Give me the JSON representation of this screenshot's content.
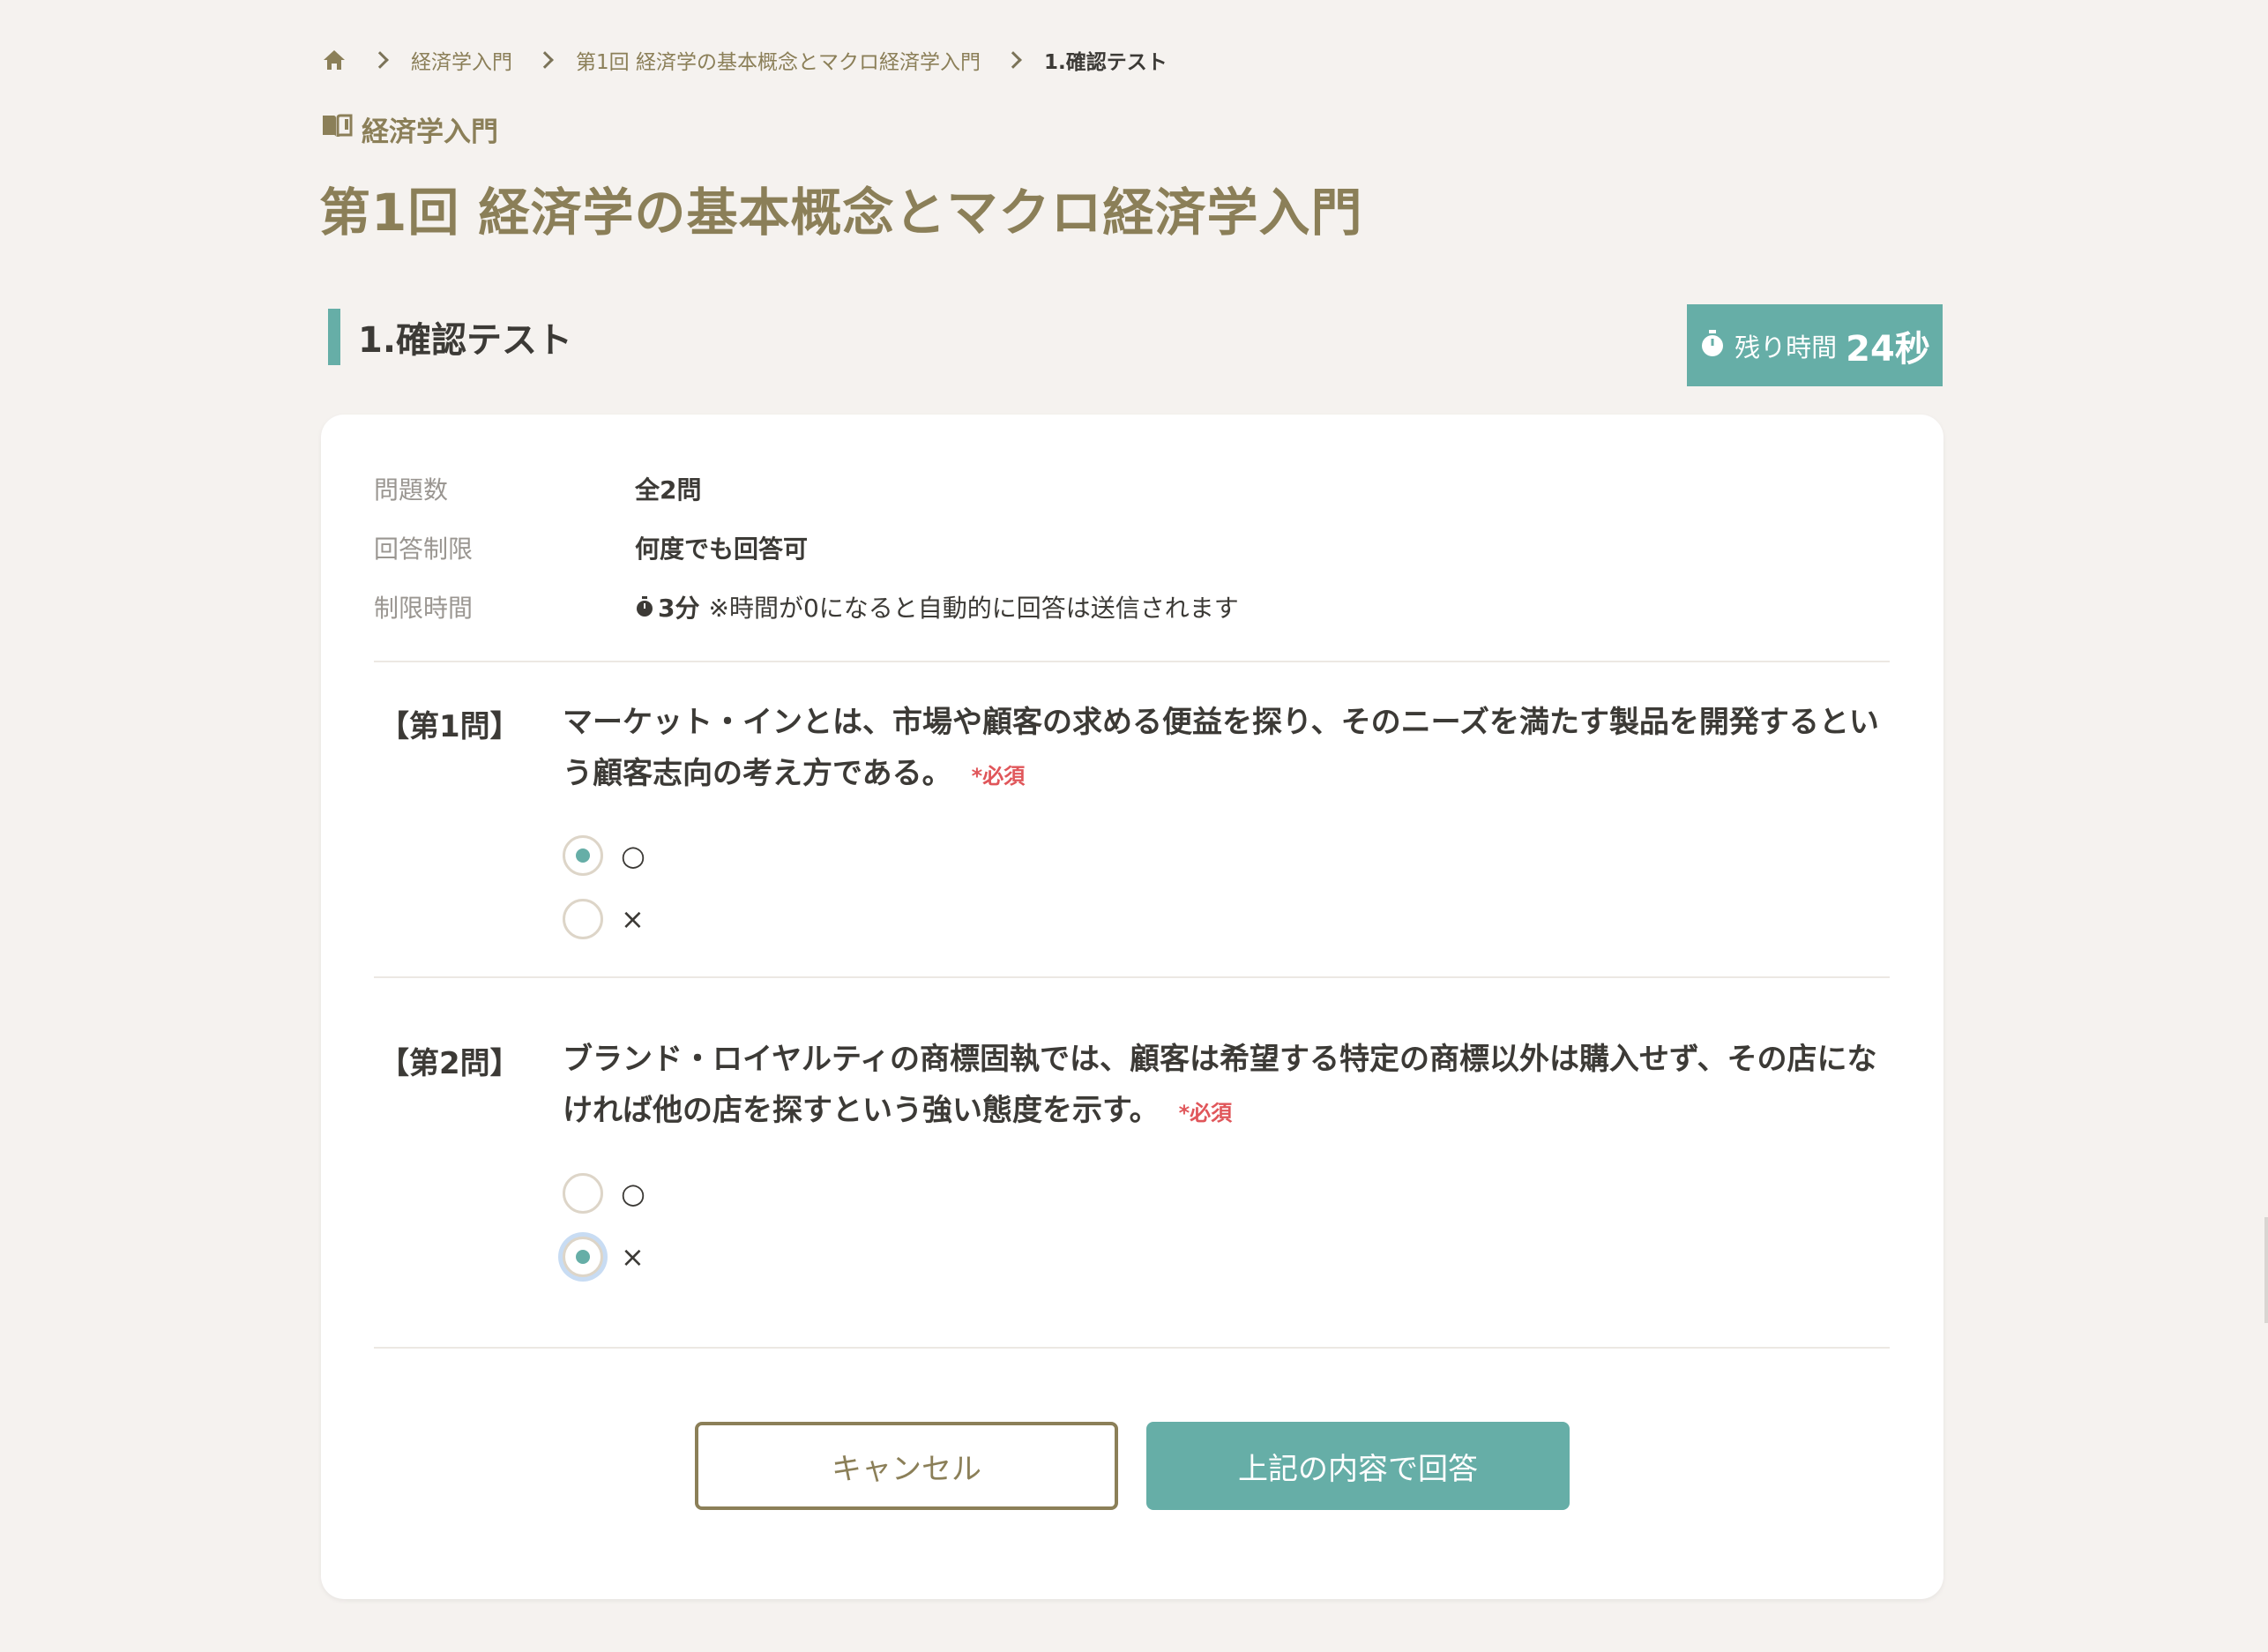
{
  "breadcrumb": {
    "items": [
      "経済学入門",
      "第1回 経済学の基本概念とマクロ経済学入門",
      "1.確認テスト"
    ]
  },
  "course": {
    "label": "経済学入門"
  },
  "page": {
    "title": "第1回 経済学の基本概念とマクロ経済学入門"
  },
  "section": {
    "title": "1.確認テスト"
  },
  "timer": {
    "label": "残り時間",
    "value": "24秒"
  },
  "info": {
    "count_label": "問題数",
    "count_value": "全2問",
    "limit_label": "回答制限",
    "limit_value": "何度でも回答可",
    "time_label": "制限時間",
    "time_value": "3分",
    "time_note": "※時間が0になると自動的に回答は送信されます"
  },
  "questions": [
    {
      "number": "【第1問】",
      "text": "マーケット・インとは、市場や顧客の求める便益を探り、そのニーズを満たす製品を開発するという顧客志向の考え方である。",
      "required": "*必須",
      "options": [
        "○",
        "×"
      ],
      "selected": "○"
    },
    {
      "number": "【第2問】",
      "text": "ブランド・ロイヤルティの商標固執では、顧客は希望する特定の商標以外は購入せず、その店になければ他の店を探すという強い態度を示す。",
      "required": "*必須",
      "options": [
        "○",
        "×"
      ],
      "selected": "×"
    }
  ],
  "buttons": {
    "cancel": "キャンセル",
    "submit": "上記の内容で回答"
  },
  "colors": {
    "accent": "#66aea7",
    "brand": "#8b7f58",
    "required": "#e0565a",
    "background": "#f5f2ef"
  }
}
